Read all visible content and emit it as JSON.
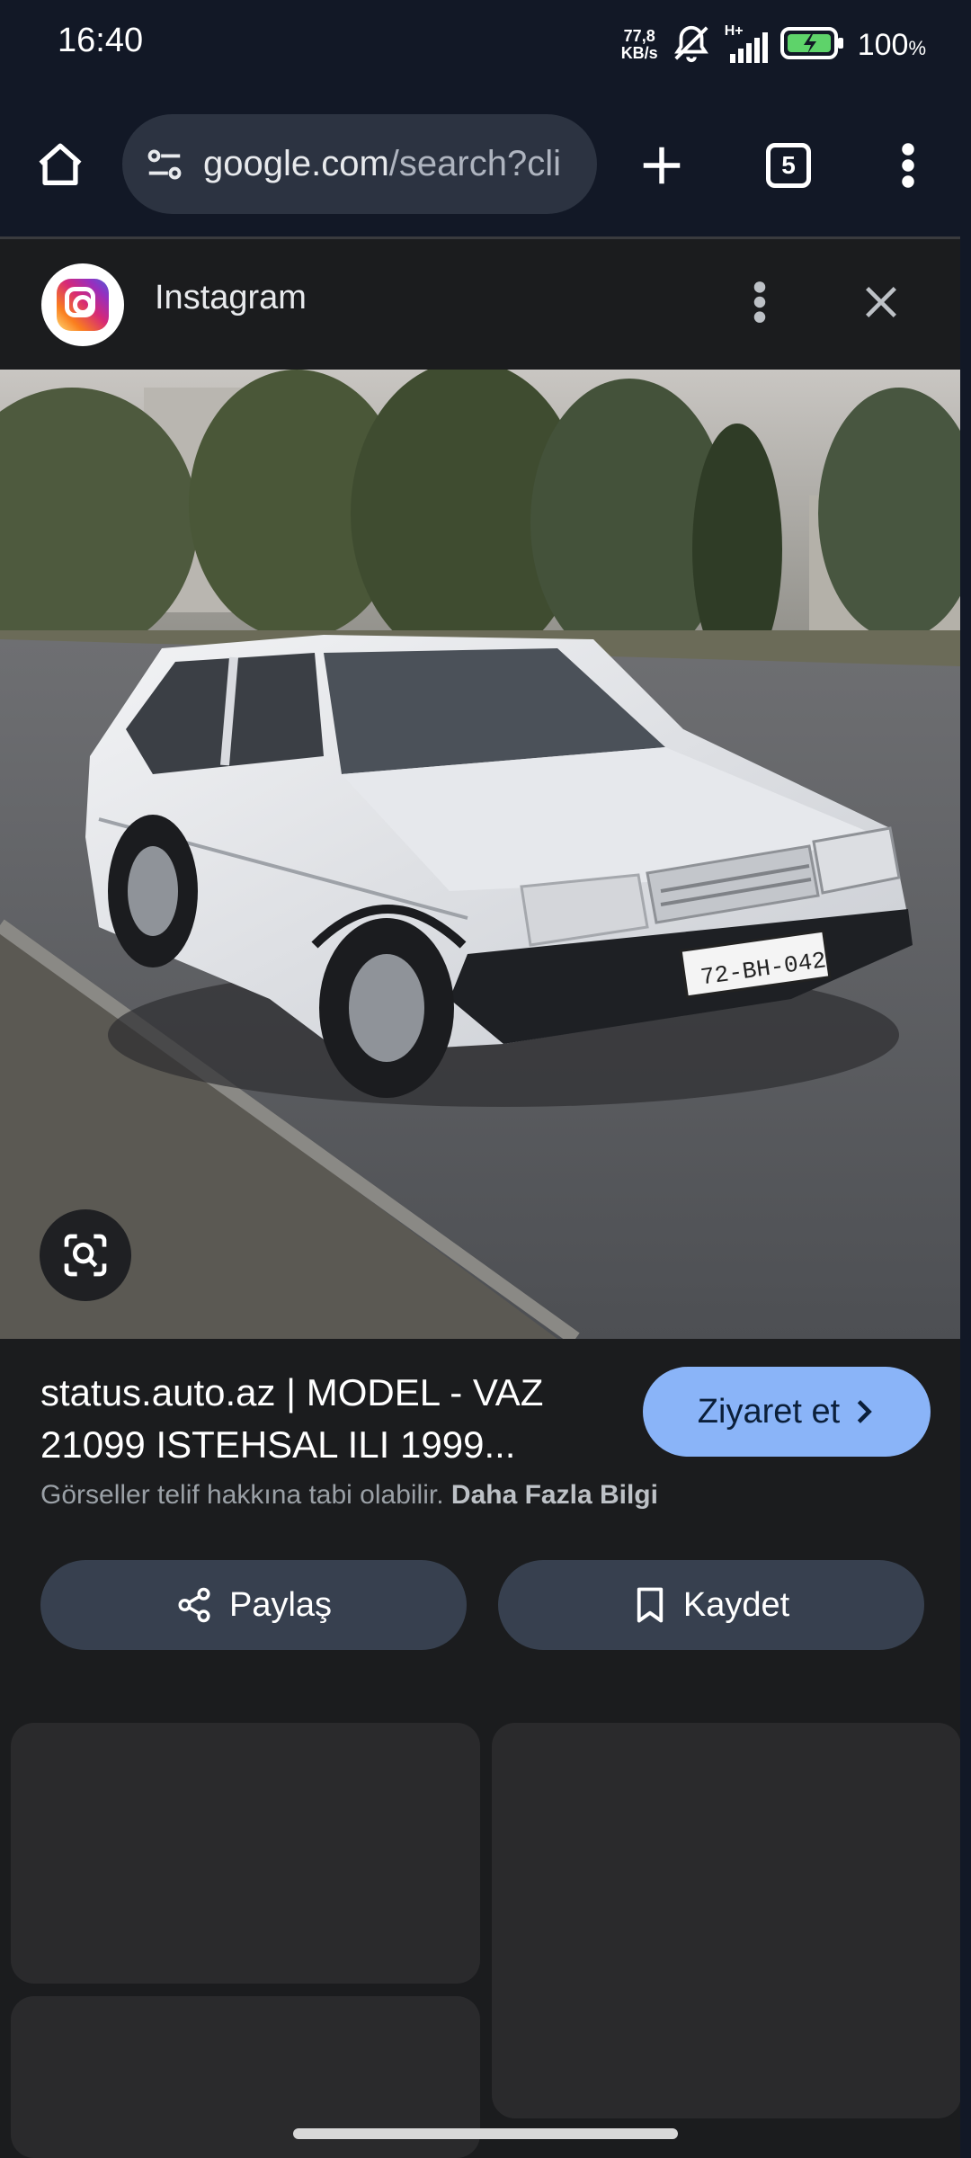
{
  "status_bar": {
    "time": "16:40",
    "net_speed_value": "77,8",
    "net_speed_unit": "KB/s",
    "network_type": "H+",
    "battery_percent": "100",
    "battery_percent_unit": "%"
  },
  "browser": {
    "url_host": "google.com",
    "url_path": "/search?cli",
    "tab_count": "5"
  },
  "viewer": {
    "source_name": "Instagram",
    "plate_text": "72-BH-042",
    "result_title": "status.auto.az | MODEL - VAZ 21099 ISTEHSAL ILI 1999...",
    "visit_label": "Ziyaret et",
    "copyright_text": "Görseller telif hakkına tabi olabilir.",
    "learn_more": "Daha Fazla Bilgi",
    "share_label": "Paylaş",
    "save_label": "Kaydet"
  }
}
